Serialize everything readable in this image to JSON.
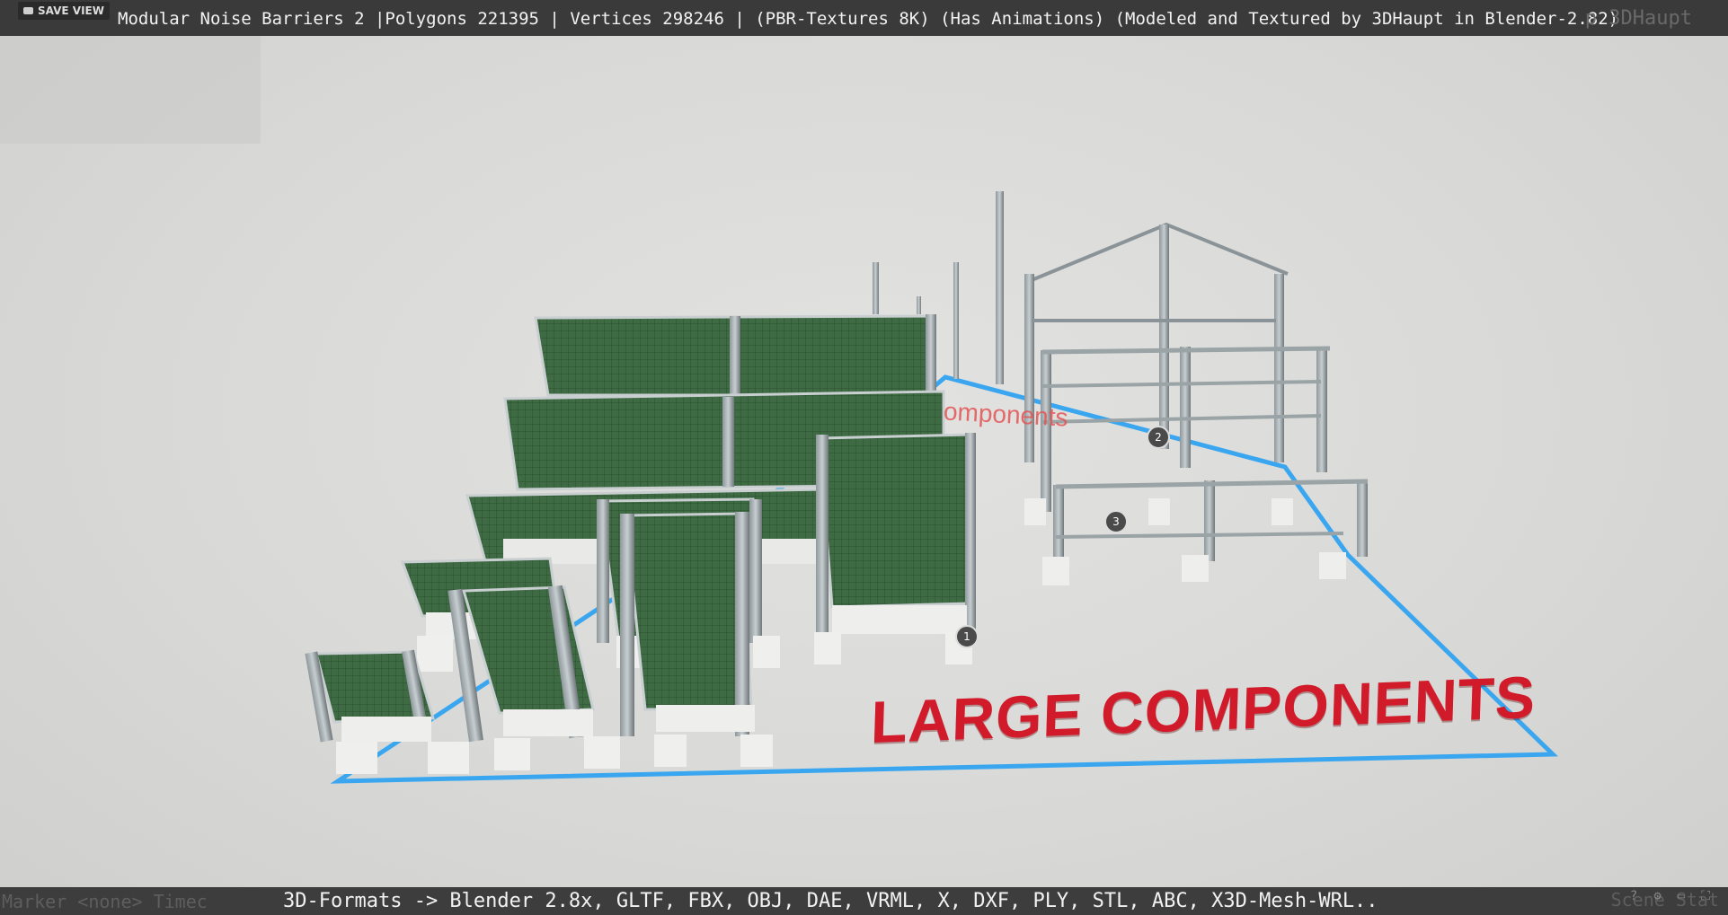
{
  "toolbar": {
    "save_view_label": "SAVE VIEW"
  },
  "header": {
    "title": "Modular Noise Barriers 2 |Polygons 221395 | Vertices 298246 | (PBR-Textures 8K) (Has Animations) (Modeled and Textured by 3DHaupt in Blender-2.82)",
    "ghost_right": "p 3DHaupt"
  },
  "scene": {
    "large_label": "LARGE COMPONENTS",
    "small_label": "omponents",
    "annotations": [
      "1",
      "2",
      "3"
    ],
    "outline_color": "#3aa6f0",
    "label_color": "#d11a2a"
  },
  "footer": {
    "formats": "3D-Formats -> Blender 2.8x, GLTF, FBX, OBJ, DAE, VRML, X, DXF, PLY, STL, ABC, X3D-Mesh-WRL..",
    "ghost_left": "Marker <none>   Timec",
    "ghost_right": "Scene Stat"
  },
  "icons": [
    "camera-icon",
    "help-icon",
    "settings-icon",
    "vr-icon",
    "fullscreen-icon"
  ]
}
